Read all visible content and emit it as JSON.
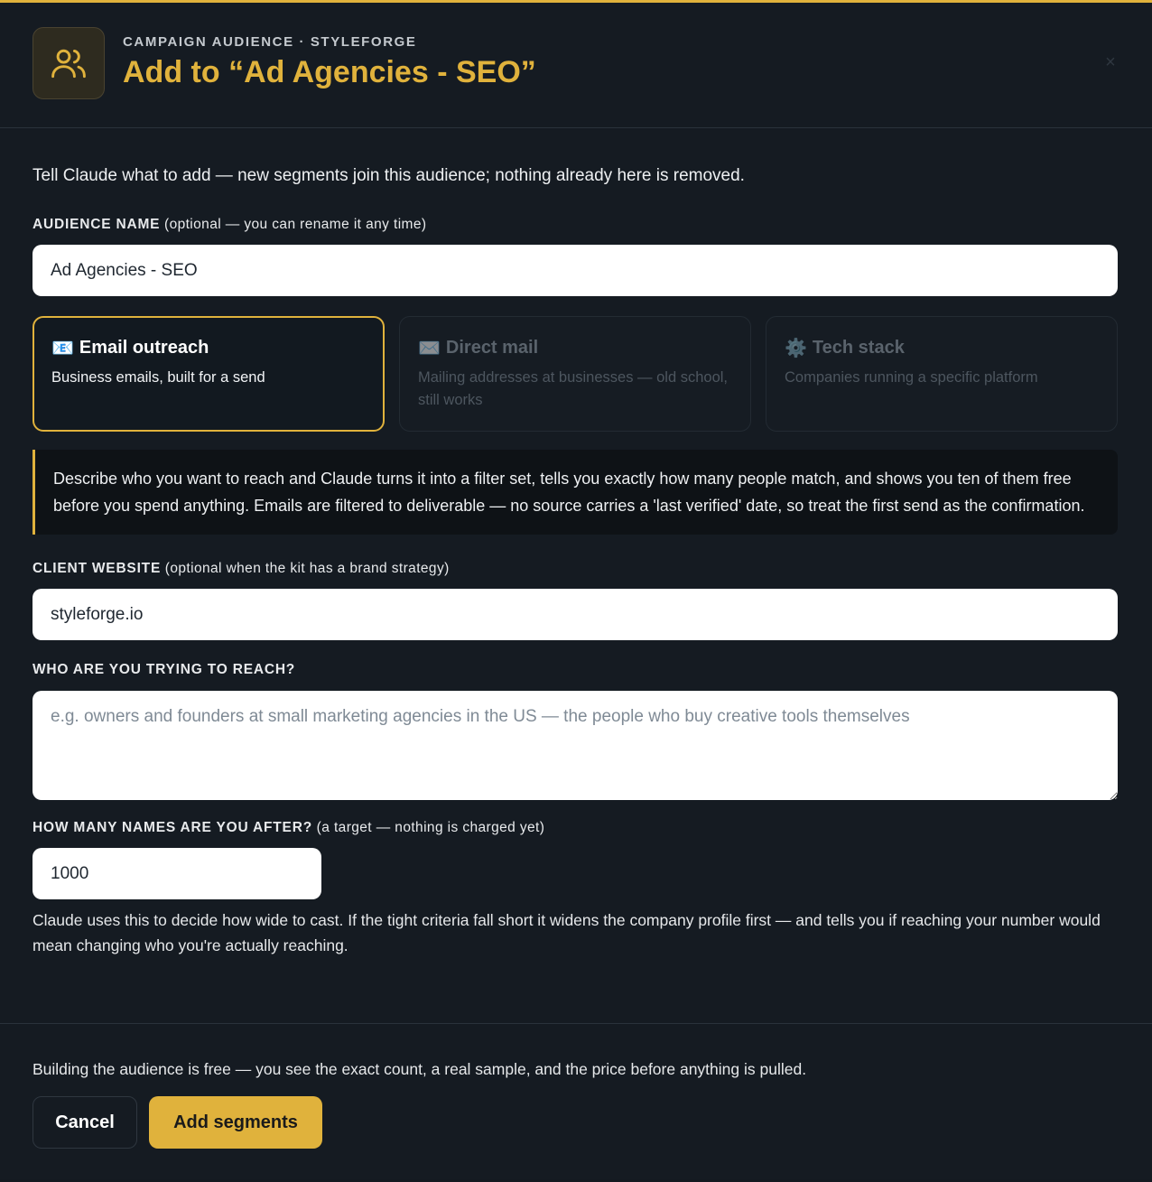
{
  "header": {
    "eyebrow": "CAMPAIGN AUDIENCE · STYLEFORGE",
    "title": "Add to “Ad Agencies - SEO”",
    "icon": "users-icon",
    "close_icon": "close-icon",
    "close_glyph": "×"
  },
  "intro": "Tell Claude what to add — new segments join this audience; nothing already here is removed.",
  "audience_name": {
    "label": "AUDIENCE NAME",
    "hint": " (optional — you can rename it any time)",
    "value": "Ad Agencies - SEO"
  },
  "channels": [
    {
      "icon": "📧",
      "title": "Email outreach",
      "desc": "Business emails, built for a send",
      "active": true
    },
    {
      "icon": "✉️",
      "title": "Direct mail",
      "desc": "Mailing addresses at businesses — old school, still works",
      "active": false
    },
    {
      "icon": "⚙️",
      "title": "Tech stack",
      "desc": "Companies running a specific platform",
      "active": false
    }
  ],
  "info": "Describe who you want to reach and Claude turns it into a filter set, tells you exactly how many people match, and shows you ten of them free before you spend anything. Emails are filtered to deliverable — no source carries a 'last verified' date, so treat the first send as the confirmation.",
  "client_website": {
    "label": "CLIENT WEBSITE",
    "hint": " (optional when the kit has a brand strategy)",
    "value": "styleforge.io"
  },
  "reach": {
    "label": "WHO ARE YOU TRYING TO REACH?",
    "placeholder": "e.g. owners and founders at small marketing agencies in the US — the people who buy creative tools themselves",
    "value": ""
  },
  "target": {
    "label": "HOW MANY NAMES ARE YOU AFTER?",
    "hint": " (a target — nothing is charged yet)",
    "value": "1000",
    "help": "Claude uses this to decide how wide to cast. If the tight criteria fall short it widens the company profile first — and tells you if reaching your number would mean changing who you're actually reaching."
  },
  "footer": {
    "note": "Building the audience is free — you see the exact count, a real sample, and the price before anything is pulled.",
    "cancel_label": "Cancel",
    "submit_label": "Add segments"
  },
  "colors": {
    "accent": "#e0b23c",
    "background": "#151b22"
  }
}
